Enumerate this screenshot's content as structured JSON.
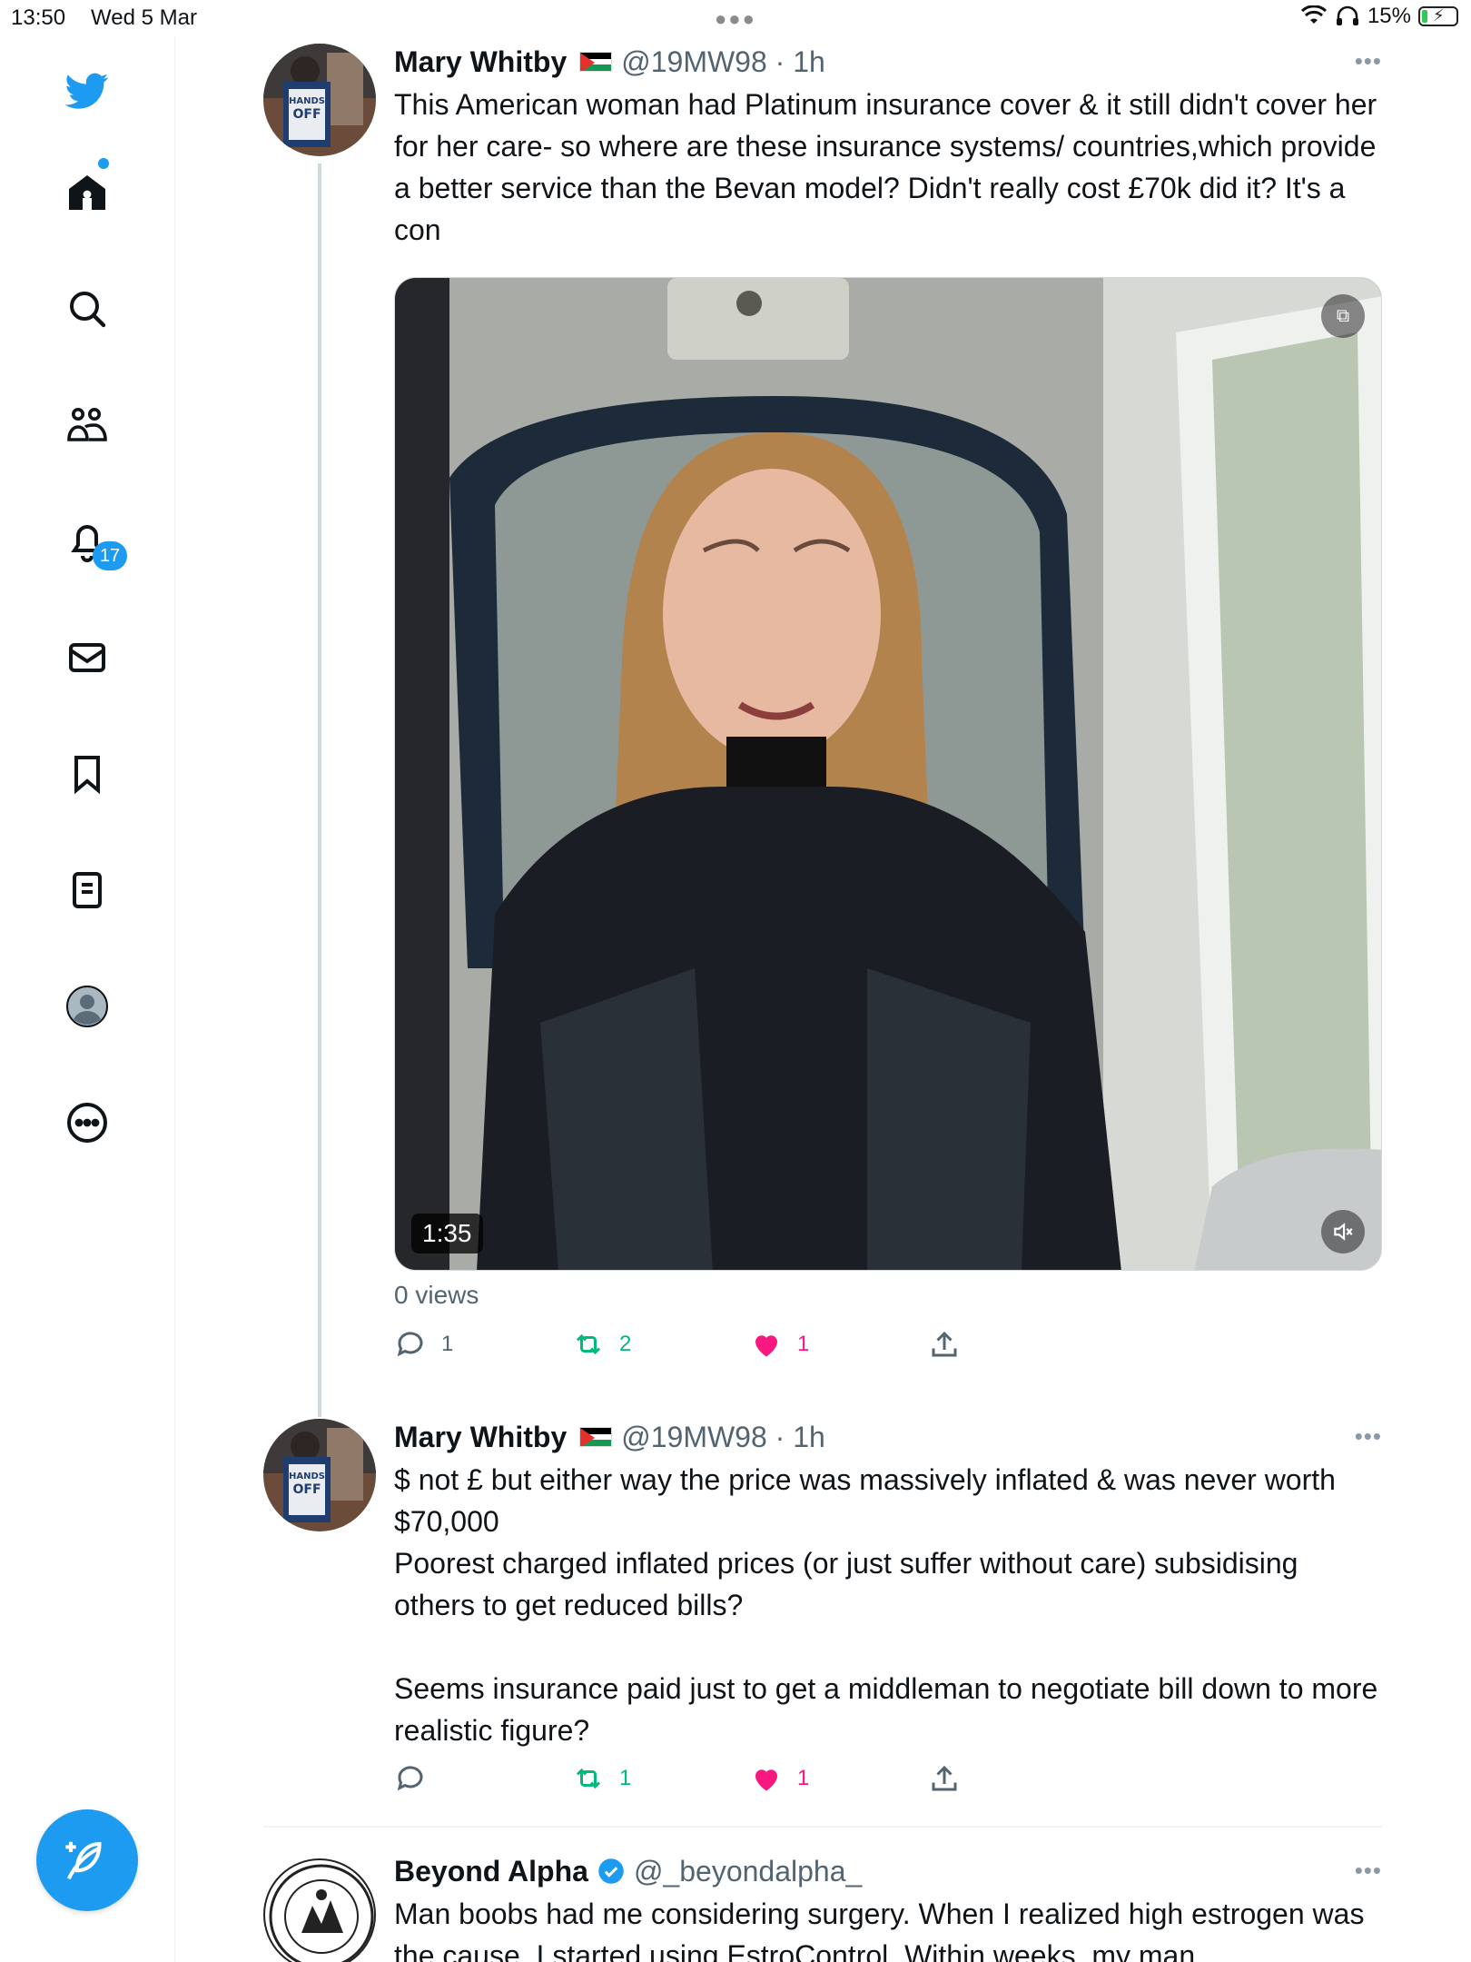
{
  "status_bar": {
    "time": "13:50",
    "date": "Wed 5 Mar",
    "battery_percent": "15%"
  },
  "sidebar": {
    "notification_count": "17",
    "items": [
      {
        "name": "twitter-logo-icon"
      },
      {
        "name": "home-icon"
      },
      {
        "name": "search-icon"
      },
      {
        "name": "communities-icon"
      },
      {
        "name": "notifications-icon"
      },
      {
        "name": "messages-icon"
      },
      {
        "name": "bookmarks-icon"
      },
      {
        "name": "lists-icon"
      },
      {
        "name": "profile-icon"
      },
      {
        "name": "more-icon"
      }
    ]
  },
  "tweets": [
    {
      "name": "Mary Whitby",
      "handle": "@19MW98 · 1h",
      "text": "This American woman had Platinum insurance cover & it still didn't cover her for her care- so where are these insurance systems/ countries,which provide a better service than the Bevan model? Didn't really cost £70k did it? It's a con",
      "video_duration": "1:35",
      "views": "0 views",
      "replies": "1",
      "retweets": "2",
      "likes": "1"
    },
    {
      "name": "Mary Whitby",
      "handle": "@19MW98 · 1h",
      "text": "$ not £ but either way the price was massively inflated & was never worth $70,000\nPoorest charged inflated prices (or just suffer without care) subsidising others to get reduced bills?\n\nSeems insurance paid just to get a middleman to negotiate bill down to more realistic figure?",
      "replies": "",
      "retweets": "1",
      "likes": "1"
    },
    {
      "name": "Beyond Alpha",
      "handle": "@_beyondalpha_",
      "text": "Man boobs had me considering surgery. When I realized high estrogen was the cause, I started using EstroControl. Within weeks, my man"
    }
  ],
  "colors": {
    "accent": "#1d9bf0",
    "like": "#f91880",
    "retweet": "#00ba7c",
    "muted": "#536471"
  }
}
